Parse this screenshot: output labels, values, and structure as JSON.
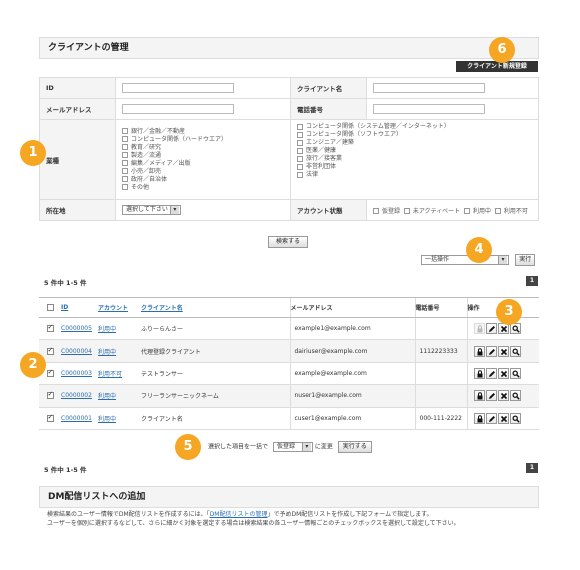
{
  "header": {
    "title": "クライアントの管理",
    "register_label": "クライアント新規登録"
  },
  "badges": [
    "1",
    "2",
    "3",
    "4",
    "5",
    "6"
  ],
  "search": {
    "id_label": "ID",
    "client_name_label": "クライアント名",
    "email_label": "メールアドレス",
    "phone_label": "電話番号",
    "industry_label": "業種",
    "industries_left": [
      "銀行／金融／不動産",
      "コンピュータ関係（ハードウエア）",
      "教育／研究",
      "製造／流通",
      "編集／メディア／出版",
      "小売／卸売",
      "政府／自治体",
      "その他"
    ],
    "industries_right": [
      "コンピュータ関係（システム管理／インターネット）",
      "コンピュータ関係（ソフトウエア）",
      "エンジニア／建築",
      "医薬／健康",
      "旅行／接客業",
      "非営利団体",
      "法律"
    ],
    "location_label": "所在地",
    "location_value": "選択して下さい",
    "account_status_label": "アカウント状態",
    "statuses": [
      "仮登録",
      "未アクティベート",
      "利用中",
      "利用不可"
    ],
    "search_button": "検索する"
  },
  "bulk_top": {
    "select_value": "一括操作",
    "execute": "実行"
  },
  "pagination": {
    "count": "5 件中 1-5 件",
    "page": "1"
  },
  "table": {
    "headers": {
      "id": "ID",
      "account": "アカウント",
      "client_name": "クライアント名",
      "email": "メールアドレス",
      "phone": "電話番号",
      "ops": "操作"
    },
    "rows": [
      {
        "id": "C0000005",
        "account": "利用中",
        "name": "ふりーらんさー",
        "email": "example1@example.com",
        "phone": ""
      },
      {
        "id": "C0000004",
        "account": "利用中",
        "name": "代理登録クライアント",
        "email": "dairiuser@example.com",
        "phone": "1112223333"
      },
      {
        "id": "C0000003",
        "account": "利用不可",
        "name": "テストランサー",
        "email": "example@example.com",
        "phone": ""
      },
      {
        "id": "C0000002",
        "account": "利用中",
        "name": "フリーランサーニックネーム",
        "email": "nuser1@example.com",
        "phone": ""
      },
      {
        "id": "C0000001",
        "account": "利用中",
        "name": "クライアント名",
        "email": "cuser1@example.com",
        "phone": "000-111-2222"
      }
    ]
  },
  "bulk_bottom": {
    "prefix": "選択した項目を一括で",
    "select_value": "仮登録",
    "suffix": "に変更",
    "execute": "実行する"
  },
  "dm": {
    "title": "DM配信リストへの追加",
    "line1_a": "検索結果のユーザー情報でDM配信リストを作成するには、「",
    "line1_link": "DM配信リストの管理",
    "line1_b": "」で予めDM配信リストを作成し下記フォームで指定します。",
    "line2": "ユーザーを個別に選択するなどして、さらに細かく対象を選定する場合は検索結果の各ユーザー情報ごとのチェックボックスを選択して設定して下さい。"
  },
  "colors": {
    "badge": "#f5a623",
    "link": "#2a6db0",
    "dark": "#333333"
  }
}
